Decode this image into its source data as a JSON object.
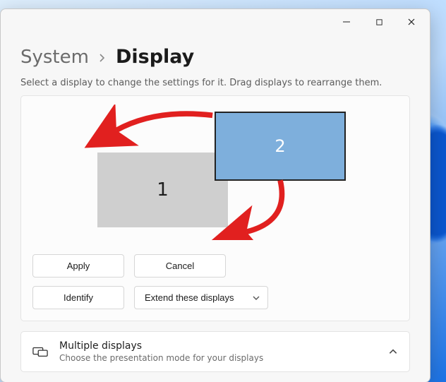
{
  "breadcrumb": {
    "parent": "System",
    "current": "Display"
  },
  "subtitle": "Select a display to change the settings for it. Drag displays to rearrange them.",
  "monitors": {
    "one_label": "1",
    "two_label": "2"
  },
  "buttons": {
    "apply": "Apply",
    "cancel": "Cancel",
    "identify": "Identify",
    "mode_select": "Extend these displays"
  },
  "sections": {
    "multiple_displays": {
      "title": "Multiple displays",
      "desc": "Choose the presentation mode for your displays"
    }
  }
}
